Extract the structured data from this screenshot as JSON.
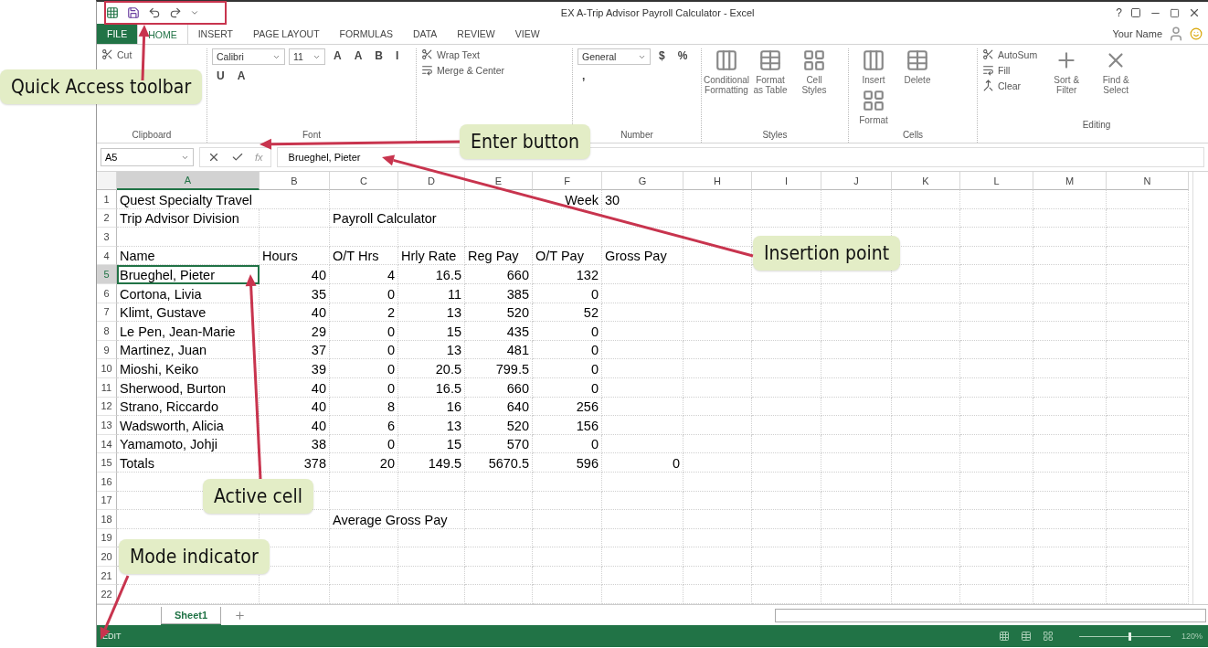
{
  "window": {
    "title": "EX A-Trip Advisor Payroll Calculator - Excel",
    "help": "?",
    "account": "Your Name"
  },
  "ribbon_tabs": [
    {
      "label": "FILE",
      "kind": "file",
      "selected": false
    },
    {
      "label": "HOME",
      "kind": "tab",
      "selected": true
    },
    {
      "label": "INSERT",
      "kind": "tab",
      "selected": false
    },
    {
      "label": "PAGE LAYOUT",
      "kind": "tab",
      "selected": false
    },
    {
      "label": "FORMULAS",
      "kind": "tab",
      "selected": false
    },
    {
      "label": "DATA",
      "kind": "tab",
      "selected": false
    },
    {
      "label": "REVIEW",
      "kind": "tab",
      "selected": false
    },
    {
      "label": "VIEW",
      "kind": "tab",
      "selected": false
    }
  ],
  "ribbon_groups": [
    {
      "label": "Clipboard",
      "commands": [
        {
          "label": "Cut",
          "kind": "small"
        }
      ]
    },
    {
      "label": "Font",
      "commands": [
        {
          "label": "Calibri",
          "kind": "dropdown"
        },
        {
          "label": "11",
          "kind": "dropdown"
        },
        {
          "label": "A",
          "kind": "glyph"
        },
        {
          "label": "A",
          "kind": "glyph"
        },
        {
          "label": "B",
          "kind": "glyph"
        },
        {
          "label": "I",
          "kind": "glyph"
        },
        {
          "label": "U",
          "kind": "glyph"
        },
        {
          "label": "A",
          "kind": "glyph"
        }
      ]
    },
    {
      "commands": [
        {
          "label": "Wrap Text",
          "kind": "small"
        },
        {
          "label": "Merge & Center",
          "kind": "small"
        }
      ]
    },
    {
      "label": "Number",
      "commands": [
        {
          "label": "General",
          "kind": "dropdown"
        },
        {
          "label": "$",
          "kind": "glyph"
        },
        {
          "label": "%",
          "kind": "glyph"
        },
        {
          "label": ",",
          "kind": "glyph"
        }
      ]
    },
    {
      "label": "Styles",
      "commands": [
        {
          "label": "Conditional Formatting",
          "kind": "large"
        },
        {
          "label": "Format as Table",
          "kind": "large"
        },
        {
          "label": "Cell Styles",
          "kind": "large"
        }
      ]
    },
    {
      "label": "Cells",
      "commands": [
        {
          "label": "Insert",
          "kind": "large"
        },
        {
          "label": "Delete",
          "kind": "large"
        },
        {
          "label": "Format",
          "kind": "large"
        }
      ]
    },
    {
      "label": "Editing",
      "commands": [
        {
          "label": "AutoSum",
          "kind": "small"
        },
        {
          "label": "Fill",
          "kind": "small"
        },
        {
          "label": "Clear",
          "kind": "small"
        },
        {
          "label": "Sort & Filter",
          "kind": "large"
        },
        {
          "label": "Find & Select",
          "kind": "large"
        }
      ]
    }
  ],
  "formula_bar": {
    "name_box": "A5",
    "function_label": "fx",
    "value": "Brueghel, Pieter"
  },
  "columns": [
    {
      "label": "A",
      "selected": true
    },
    {
      "label": "B",
      "selected": false
    },
    {
      "label": "C",
      "selected": false
    },
    {
      "label": "D",
      "selected": false
    },
    {
      "label": "E",
      "selected": false
    },
    {
      "label": "F",
      "selected": false
    },
    {
      "label": "G",
      "selected": false
    },
    {
      "label": "H",
      "selected": false
    },
    {
      "label": "I",
      "selected": false
    },
    {
      "label": "J",
      "selected": false
    },
    {
      "label": "K",
      "selected": false
    },
    {
      "label": "L",
      "selected": false
    },
    {
      "label": "M",
      "selected": false
    },
    {
      "label": "N",
      "selected": false
    }
  ],
  "rows": [
    {
      "number": "1",
      "selected": false,
      "cells": [
        {
          "text": "Quest Specialty Travel",
          "kind": "text"
        },
        null,
        null,
        null,
        null,
        {
          "text": "Week",
          "kind": "number"
        },
        {
          "text": "30",
          "kind": "text"
        }
      ]
    },
    {
      "number": "2",
      "selected": false,
      "cells": [
        {
          "text": "Trip Advisor Division",
          "kind": "text"
        },
        null,
        {
          "text": "Payroll Calculator",
          "kind": "text"
        }
      ]
    },
    {
      "number": "3",
      "selected": false
    },
    {
      "number": "4",
      "selected": false,
      "cells": [
        {
          "text": "Name",
          "kind": "text"
        },
        {
          "text": "Hours",
          "kind": "text"
        },
        {
          "text": "O/T Hrs",
          "kind": "text"
        },
        {
          "text": "Hrly Rate",
          "kind": "text"
        },
        {
          "text": "Reg Pay",
          "kind": "text"
        },
        {
          "text": "O/T Pay",
          "kind": "text"
        },
        {
          "text": "Gross Pay",
          "kind": "text"
        }
      ]
    },
    {
      "number": "5",
      "selected": true,
      "cells": [
        {
          "text": "Brueghel, Pieter",
          "kind": "text"
        },
        {
          "text": "40",
          "kind": "number"
        },
        {
          "text": "4",
          "kind": "number"
        },
        {
          "text": "16.5",
          "kind": "number"
        },
        {
          "text": "660",
          "kind": "number"
        },
        {
          "text": "132",
          "kind": "number"
        }
      ]
    },
    {
      "number": "6",
      "selected": false,
      "cells": [
        {
          "text": "Cortona, Livia",
          "kind": "text"
        },
        {
          "text": "35",
          "kind": "number"
        },
        {
          "text": "0",
          "kind": "number"
        },
        {
          "text": "11",
          "kind": "number"
        },
        {
          "text": "385",
          "kind": "number"
        },
        {
          "text": "0",
          "kind": "number"
        }
      ]
    },
    {
      "number": "7",
      "selected": false,
      "cells": [
        {
          "text": "Klimt, Gustave",
          "kind": "text"
        },
        {
          "text": "40",
          "kind": "number"
        },
        {
          "text": "2",
          "kind": "number"
        },
        {
          "text": "13",
          "kind": "number"
        },
        {
          "text": "520",
          "kind": "number"
        },
        {
          "text": "52",
          "kind": "number"
        }
      ]
    },
    {
      "number": "8",
      "selected": false,
      "cells": [
        {
          "text": "Le Pen, Jean-Marie",
          "kind": "text"
        },
        {
          "text": "29",
          "kind": "number"
        },
        {
          "text": "0",
          "kind": "number"
        },
        {
          "text": "15",
          "kind": "number"
        },
        {
          "text": "435",
          "kind": "number"
        },
        {
          "text": "0",
          "kind": "number"
        }
      ]
    },
    {
      "number": "9",
      "selected": false,
      "cells": [
        {
          "text": "Martinez, Juan",
          "kind": "text"
        },
        {
          "text": "37",
          "kind": "number"
        },
        {
          "text": "0",
          "kind": "number"
        },
        {
          "text": "13",
          "kind": "number"
        },
        {
          "text": "481",
          "kind": "number"
        },
        {
          "text": "0",
          "kind": "number"
        }
      ]
    },
    {
      "number": "10",
      "selected": false,
      "cells": [
        {
          "text": "Mioshi, Keiko",
          "kind": "text"
        },
        {
          "text": "39",
          "kind": "number"
        },
        {
          "text": "0",
          "kind": "number"
        },
        {
          "text": "20.5",
          "kind": "number"
        },
        {
          "text": "799.5",
          "kind": "number"
        },
        {
          "text": "0",
          "kind": "number"
        }
      ]
    },
    {
      "number": "11",
      "selected": false,
      "cells": [
        {
          "text": "Sherwood, Burton",
          "kind": "text"
        },
        {
          "text": "40",
          "kind": "number"
        },
        {
          "text": "0",
          "kind": "number"
        },
        {
          "text": "16.5",
          "kind": "number"
        },
        {
          "text": "660",
          "kind": "number"
        },
        {
          "text": "0",
          "kind": "number"
        }
      ]
    },
    {
      "number": "12",
      "selected": false,
      "cells": [
        {
          "text": "Strano, Riccardo",
          "kind": "text"
        },
        {
          "text": "40",
          "kind": "number"
        },
        {
          "text": "8",
          "kind": "number"
        },
        {
          "text": "16",
          "kind": "number"
        },
        {
          "text": "640",
          "kind": "number"
        },
        {
          "text": "256",
          "kind": "number"
        }
      ]
    },
    {
      "number": "13",
      "selected": false,
      "cells": [
        {
          "text": "Wadsworth, Alicia",
          "kind": "text"
        },
        {
          "text": "40",
          "kind": "number"
        },
        {
          "text": "6",
          "kind": "number"
        },
        {
          "text": "13",
          "kind": "number"
        },
        {
          "text": "520",
          "kind": "number"
        },
        {
          "text": "156",
          "kind": "number"
        }
      ]
    },
    {
      "number": "14",
      "selected": false,
      "cells": [
        {
          "text": "Yamamoto, Johji",
          "kind": "text"
        },
        {
          "text": "38",
          "kind": "number"
        },
        {
          "text": "0",
          "kind": "number"
        },
        {
          "text": "15",
          "kind": "number"
        },
        {
          "text": "570",
          "kind": "number"
        },
        {
          "text": "0",
          "kind": "number"
        }
      ]
    },
    {
      "number": "15",
      "selected": false,
      "cells": [
        {
          "text": "Totals",
          "kind": "text"
        },
        {
          "text": "378",
          "kind": "number"
        },
        {
          "text": "20",
          "kind": "number"
        },
        {
          "text": "149.5",
          "kind": "number"
        },
        {
          "text": "5670.5",
          "kind": "number"
        },
        {
          "text": "596",
          "kind": "number"
        },
        {
          "text": "0",
          "kind": "number"
        }
      ]
    },
    {
      "number": "16",
      "selected": false
    },
    {
      "number": "17",
      "selected": false
    },
    {
      "number": "18",
      "selected": false,
      "cells": [
        null,
        null,
        {
          "text": "Average Gross Pay",
          "kind": "text"
        }
      ]
    },
    {
      "number": "19",
      "selected": false
    },
    {
      "number": "20",
      "selected": false
    },
    {
      "number": "21",
      "selected": false
    },
    {
      "number": "22",
      "selected": false
    }
  ],
  "sheet_tabs": [
    {
      "label": "Sheet1",
      "selected": true
    }
  ],
  "status_bar": {
    "mode": "EDIT",
    "zoom": "120%",
    "zoom_slider": {
      "level": 0.55
    }
  },
  "callouts": [
    {
      "text": "Quick Access toolbar",
      "kind": "qat"
    },
    {
      "text": "Enter button",
      "kind": "enter"
    },
    {
      "text": "Insertion point",
      "kind": "insertion"
    },
    {
      "text": "Active cell",
      "kind": "active"
    },
    {
      "text": "Mode indicator",
      "kind": "mode"
    }
  ]
}
